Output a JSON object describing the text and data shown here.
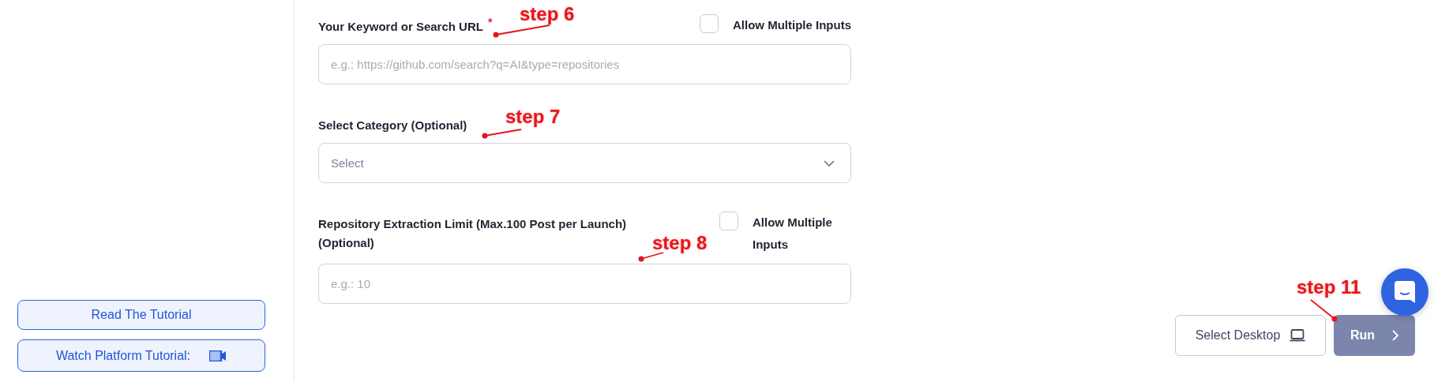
{
  "sidebar": {
    "buttons": [
      {
        "label": "Read The Tutorial",
        "kind": "text"
      },
      {
        "label": "Watch Platform Tutorial:",
        "kind": "video"
      }
    ]
  },
  "fields": [
    {
      "label": "Your Keyword or Search URL",
      "required_mark": "*",
      "kind": "input",
      "placeholder": "e.g.: https://github.com/search?q=AI&type=repositories",
      "option": {
        "label": "Allow Multiple Inputs",
        "checked": false
      }
    },
    {
      "label": "Select Category (Optional)",
      "kind": "select",
      "placeholder": "Select"
    },
    {
      "label": "Repository Extraction Limit (Max.100 Post per Launch) (Optional)",
      "kind": "input",
      "placeholder": "e.g.: 10",
      "option": {
        "label": "Allow Multiple Inputs",
        "checked": false
      }
    }
  ],
  "actions": {
    "select_desktop": "Select Desktop",
    "run": {
      "label": "Run",
      "disabled": true
    }
  },
  "annotations": [
    {
      "text": "step 6"
    },
    {
      "text": "step 7"
    },
    {
      "text": "step 8"
    },
    {
      "text": "step 11"
    }
  ]
}
